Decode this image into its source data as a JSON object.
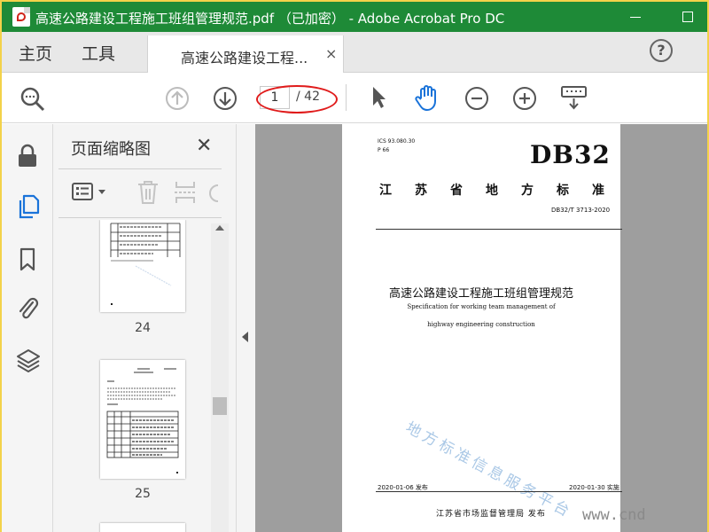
{
  "window": {
    "title": "高速公路建设工程施工班组管理规范.pdf （已加密） - Adobe Acrobat Pro DC",
    "accent": "#1e8a37",
    "frame_color": "#f3d24a"
  },
  "nav": {
    "home": "主页",
    "tools": "工具"
  },
  "tab": {
    "label": "高速公路建设工程...",
    "close": "×"
  },
  "header": {
    "help": "?"
  },
  "toolbar": {
    "current_page": "1",
    "total_pages": "/ 42",
    "highlight_color": "#e01b1b"
  },
  "panel": {
    "title": "页面缩略图",
    "close": "✕",
    "thumbnails": [
      {
        "page": "24"
      },
      {
        "page": "25"
      }
    ]
  },
  "document": {
    "meta_ics": "ICS 93.080.30",
    "meta_ccs": "P 66",
    "std_logo": "DB32",
    "std_region": "江苏省地方标准",
    "std_code": "DB32/T 3713-2020",
    "title_zh": "高速公路建设工程施工班组管理规范",
    "title_en_1": "Specification for working team management of",
    "title_en_2": "highway engineering construction",
    "watermark": "地方标准信息服务平台",
    "release_date": "2020-01-06 发布",
    "implement_date": "2020-01-30 实施",
    "issuer": "江苏省市场监督管理局   发布"
  },
  "site_mark": "www.cnd"
}
